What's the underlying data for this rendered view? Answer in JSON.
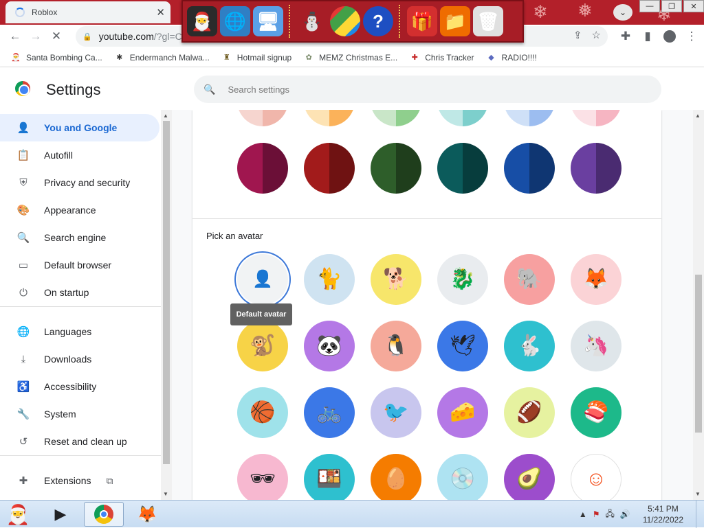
{
  "tab": {
    "title": "Roblox",
    "close": "✕"
  },
  "window": {
    "minimize": "—",
    "restore": "❐",
    "close": "✕"
  },
  "omnibox": {
    "host": "youtube.com",
    "rest": "/?gl=C"
  },
  "bookmarks": [
    {
      "label": "Santa Bombing Ca...",
      "icon": "santa-icon",
      "color": "#c62828"
    },
    {
      "label": "Endermanch Malwa...",
      "icon": "spider-icon",
      "color": "#333333"
    },
    {
      "label": "Hotmail signup",
      "icon": "person-icon",
      "color": "#6d5a1e"
    },
    {
      "label": "MEMZ Christmas E...",
      "icon": "cat-icon",
      "color": "#7a8a6a"
    },
    {
      "label": "Chris Tracker",
      "icon": "tracker-icon",
      "color": "#c62828"
    },
    {
      "label": "RADIO!!!!",
      "icon": "radio-icon",
      "color": "#5c6bc0"
    }
  ],
  "header": {
    "title": "Settings",
    "search_placeholder": "Search settings"
  },
  "nav": [
    {
      "label": "You and Google",
      "icon": "person-icon",
      "active": true
    },
    {
      "label": "Autofill",
      "icon": "clipboard-icon"
    },
    {
      "label": "Privacy and security",
      "icon": "shield-icon"
    },
    {
      "label": "Appearance",
      "icon": "palette-icon"
    },
    {
      "label": "Search engine",
      "icon": "search-icon"
    },
    {
      "label": "Default browser",
      "icon": "browser-icon"
    },
    {
      "label": "On startup",
      "icon": "power-icon"
    },
    {
      "label": "Languages",
      "icon": "globe-icon"
    },
    {
      "label": "Downloads",
      "icon": "download-icon"
    },
    {
      "label": "Accessibility",
      "icon": "accessibility-icon"
    },
    {
      "label": "System",
      "icon": "wrench-icon"
    },
    {
      "label": "Reset and clean up",
      "icon": "history-icon"
    },
    {
      "label": "Extensions",
      "icon": "puzzle-icon",
      "trailing_icon": "open-in-new-icon"
    }
  ],
  "colors_top_row": [
    {
      "a": "#f6d5cf",
      "b": "#f0b6ab"
    },
    {
      "a": "#fde3b4",
      "b": "#fbb25a"
    },
    {
      "a": "#c9e6c8",
      "b": "#8fcf8d"
    },
    {
      "a": "#bfe8e6",
      "b": "#7dcfcc"
    },
    {
      "a": "#cfe0f7",
      "b": "#9cbdf0"
    },
    {
      "a": "#fbe1e6",
      "b": "#f6b5c2"
    }
  ],
  "colors_row": [
    {
      "a": "#a0164f",
      "b": "#6b0f37"
    },
    {
      "a": "#a21b1b",
      "b": "#6f1212"
    },
    {
      "a": "#2e5e2a",
      "b": "#1f3e1c"
    },
    {
      "a": "#0b5b5b",
      "b": "#073d3d"
    },
    {
      "a": "#174ea6",
      "b": "#0f3672"
    },
    {
      "a": "#6a3fa0",
      "b": "#4a2b71"
    }
  ],
  "avatars": {
    "label": "Pick an avatar",
    "tooltip": "Default avatar",
    "items": [
      {
        "name": "default-avatar",
        "bg": "#eef1f5",
        "glyph": "👤"
      },
      {
        "name": "cat-avatar",
        "bg": "#cfe3f1",
        "glyph": "🐈"
      },
      {
        "name": "corgi-avatar",
        "bg": "#f7e66b",
        "glyph": "🐕"
      },
      {
        "name": "dragon-avatar",
        "bg": "#e9ecef",
        "glyph": "🐉"
      },
      {
        "name": "elephant-avatar",
        "bg": "#f7a0a0",
        "glyph": "🐘"
      },
      {
        "name": "fox-avatar",
        "bg": "#fbd3d6",
        "glyph": "🦊"
      },
      {
        "name": "monkey-avatar",
        "bg": "#f7d347",
        "glyph": "🐒"
      },
      {
        "name": "panda-avatar",
        "bg": "#b478e6",
        "glyph": "🐼"
      },
      {
        "name": "penguin-avatar",
        "bg": "#f5a99a",
        "glyph": "🐧"
      },
      {
        "name": "bird-avatar",
        "bg": "#3b78e7",
        "glyph": "🕊"
      },
      {
        "name": "rabbit-avatar",
        "bg": "#2ec0cf",
        "glyph": "🐇"
      },
      {
        "name": "unicorn-avatar",
        "bg": "#dfe6ea",
        "glyph": "🦄"
      },
      {
        "name": "basketball-avatar",
        "bg": "#9fe2ea",
        "glyph": "🏀"
      },
      {
        "name": "bike-avatar",
        "bg": "#3b78e7",
        "glyph": "🚲"
      },
      {
        "name": "cardinal-avatar",
        "bg": "#c8c6ee",
        "glyph": "🐦"
      },
      {
        "name": "cheese-avatar",
        "bg": "#b478e6",
        "glyph": "🧀"
      },
      {
        "name": "football-avatar",
        "bg": "#e6f2a0",
        "glyph": "🏈"
      },
      {
        "name": "sushi-plate-avatar",
        "bg": "#1db98a",
        "glyph": "🍣"
      },
      {
        "name": "sunglasses-avatar",
        "bg": "#f7b8d0",
        "glyph": "🕶"
      },
      {
        "name": "sushi-avatar",
        "bg": "#2ec0cf",
        "glyph": "🍱"
      },
      {
        "name": "tamagotchi-avatar",
        "bg": "#f57c00",
        "glyph": "🥚"
      },
      {
        "name": "vinyl-avatar",
        "bg": "#aee3f2",
        "glyph": "💿"
      },
      {
        "name": "avocado-avatar",
        "bg": "#9c4dcc",
        "glyph": "🥑"
      },
      {
        "name": "smiley-avatar",
        "bg": "#ffffff",
        "glyph": "☺"
      }
    ]
  },
  "taskbar": {
    "time": "5:41 PM",
    "date": "11/22/2022"
  }
}
